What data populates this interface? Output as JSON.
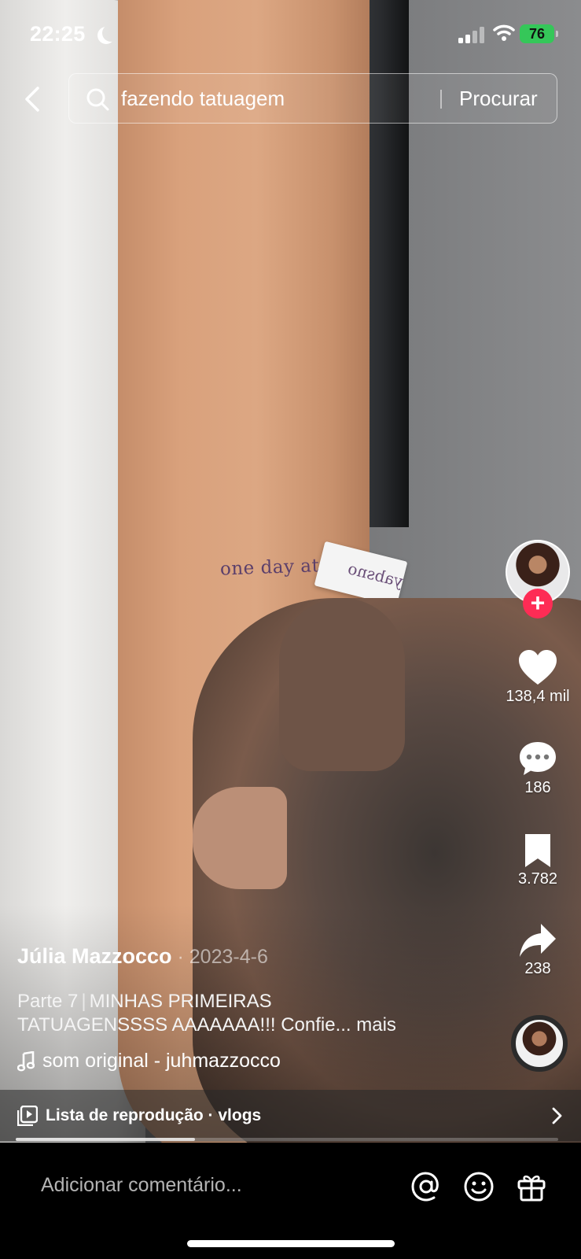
{
  "status_bar": {
    "time": "22:25",
    "battery": "76"
  },
  "search": {
    "query": "fazendo tatuagem",
    "button": "Procurar"
  },
  "video": {
    "tattoo_text": "one day at a",
    "stencil_text": "yabsno"
  },
  "actions": {
    "likes": "138,4 mil",
    "comments": "186",
    "saves": "3.782",
    "shares": "238"
  },
  "post": {
    "author": "Júlia Mazzocco",
    "date": " · 2023-4-6",
    "part": "Parte 7",
    "separator": "|",
    "description_line1": "MINHAS PRIMEIRAS",
    "description_line2": "TATUAGENSSSS AAAAAAA!!! Confie... mais",
    "sound": "som original - juhmazzocco"
  },
  "playlist": {
    "label": "Lista de reprodução · vlogs",
    "progress": 0.33
  },
  "comment_bar": {
    "placeholder": "Adicionar comentário..."
  },
  "colors": {
    "follow_accent": "#fe2c55",
    "battery_green": "#35c759"
  },
  "icons": [
    "back-icon",
    "search-icon",
    "heart-icon",
    "comment-icon",
    "bookmark-icon",
    "share-icon",
    "music-note-icon",
    "playlist-icon",
    "chevron-right-icon",
    "mention-icon",
    "emoji-icon",
    "gift-icon"
  ]
}
